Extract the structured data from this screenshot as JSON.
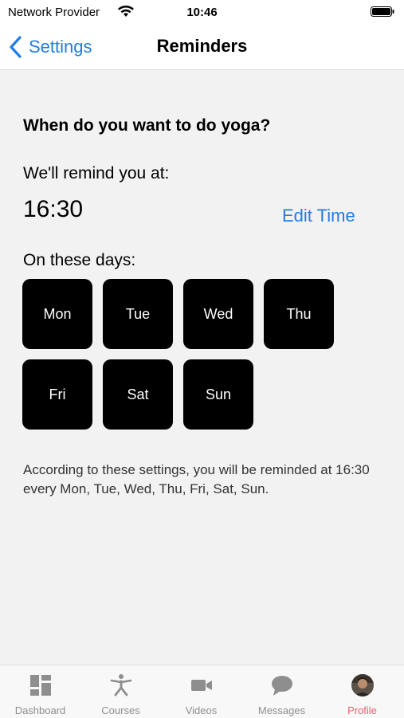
{
  "status_bar": {
    "carrier": "Network Provider",
    "time": "10:46"
  },
  "nav": {
    "back_label": "Settings",
    "title": "Reminders"
  },
  "reminder": {
    "question": "When do you want to do yoga?",
    "remind_label": "We'll remind you at:",
    "time": "16:30",
    "edit_time_label": "Edit Time",
    "days_label": "On these days:",
    "days": [
      "Mon",
      "Tue",
      "Wed",
      "Thu",
      "Fri",
      "Sat",
      "Sun"
    ],
    "summary": "According to these settings, you will be reminded at 16:30 every Mon, Tue, Wed, Thu, Fri, Sat, Sun."
  },
  "tabs": [
    {
      "label": "Dashboard",
      "icon": "dashboard-icon"
    },
    {
      "label": "Courses",
      "icon": "yoga-figure-icon"
    },
    {
      "label": "Videos",
      "icon": "video-camera-icon"
    },
    {
      "label": "Messages",
      "icon": "chat-bubble-icon"
    },
    {
      "label": "Profile",
      "icon": "profile-avatar",
      "active": true
    }
  ],
  "colors": {
    "accent": "#1e7de6",
    "active_tab": "#e8616f",
    "inactive_tab": "#8e8e8e",
    "day_tile": "#000000",
    "background": "#f2f2f2"
  }
}
